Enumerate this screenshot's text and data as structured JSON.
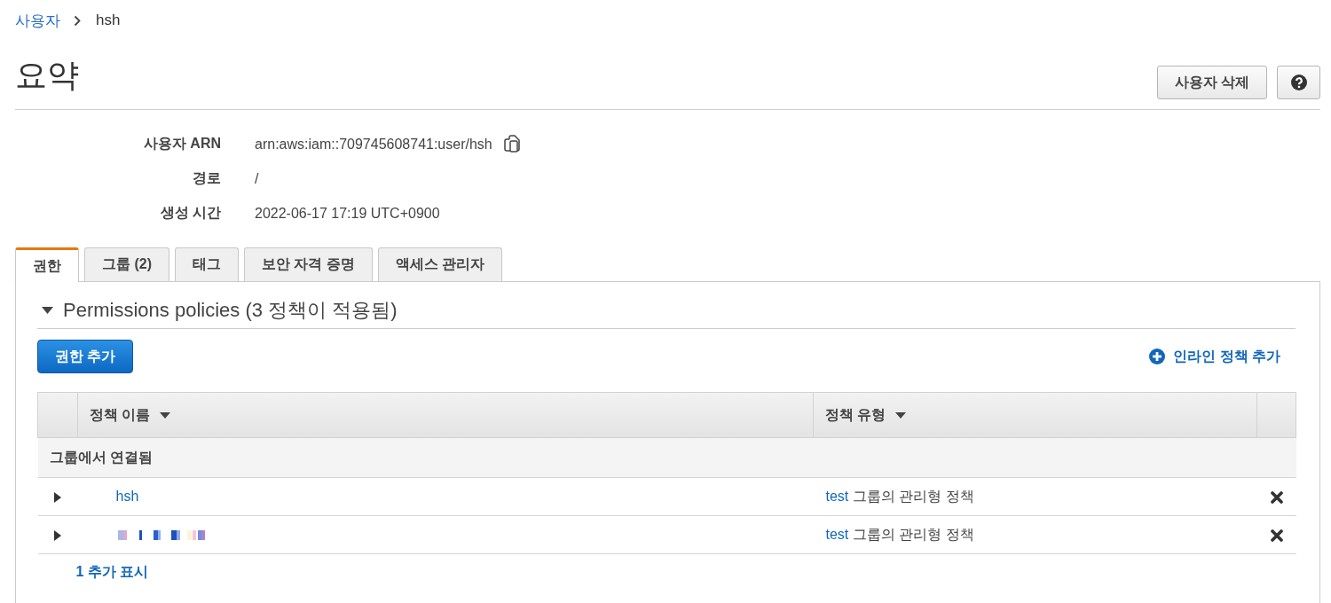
{
  "breadcrumb": {
    "parent": "사용자",
    "current": "hsh"
  },
  "header": {
    "title": "요약",
    "delete_button": "사용자 삭제"
  },
  "summary": [
    {
      "label": "사용자 ARN",
      "value": "arn:aws:iam::709745608741:user/hsh",
      "kind": "copyable"
    },
    {
      "label": "경로",
      "value": "/",
      "kind": "plain"
    },
    {
      "label": "생성 시간",
      "value": "2022-06-17 17:19 UTC+0900",
      "kind": "plain"
    }
  ],
  "tabs": [
    {
      "label": "권한",
      "selected": true
    },
    {
      "label": "그룹 (2)",
      "selected": false
    },
    {
      "label": "태그",
      "selected": false
    },
    {
      "label": "보안 자격 증명",
      "selected": false
    },
    {
      "label": "액세스 관리자",
      "selected": false
    }
  ],
  "permissions": {
    "title": "Permissions policies (3 정책이 적용됨)",
    "expanded": true,
    "add_button": "권한 추가",
    "inline_link": "인라인 정책 추가",
    "table": {
      "columns": [
        "정책 이름",
        "정책 유형"
      ],
      "groups": [
        {
          "label": "그룹에서 연결됨",
          "rows": [
            {
              "kind": "link",
              "name": "hsh",
              "expanded": false,
              "group": "test",
              "type": "그룹의 관리형 정책"
            },
            {
              "kind": "redacted",
              "expanded": false,
              "group": "test",
              "type": "그룹의 관리형 정책"
            }
          ]
        }
      ]
    },
    "show_more": "1 추가 표시"
  }
}
